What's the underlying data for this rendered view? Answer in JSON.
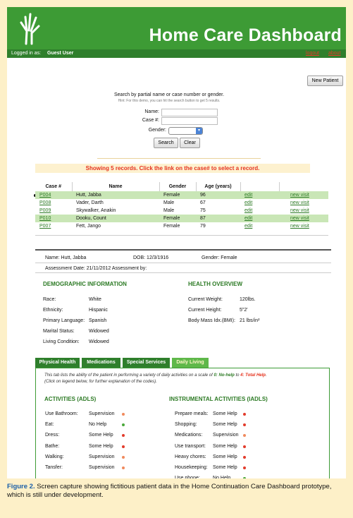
{
  "header": {
    "title": "Home Care Dashboard"
  },
  "subbar": {
    "logged_label": "Logged in as:",
    "user": "Guest User",
    "logout": "logout",
    "about": "about"
  },
  "toolbar": {
    "new_patient": "New Patient"
  },
  "search": {
    "title": "Search by partial name or case number or gender.",
    "hint": "Hint: For this demo, you can hit the search button to get 5 results.",
    "name_label": "Name:",
    "case_label": "Case #:",
    "gender_label": "Gender:",
    "gender_value": "",
    "search_button": "Search",
    "clear_button": "Clear"
  },
  "records": {
    "message": "Showing 5 records. Click the link on the case# to select a record.",
    "columns": [
      "Case #",
      "Name",
      "Gender",
      "Age (years)"
    ],
    "rows": [
      {
        "case": "P004",
        "name": "Hutt, Jabba",
        "gender": "Female",
        "age": "96",
        "edit": "edit",
        "visit": "new visit"
      },
      {
        "case": "P008",
        "name": "Vader, Darth",
        "gender": "Male",
        "age": "67",
        "edit": "edit",
        "visit": "new visit"
      },
      {
        "case": "P009",
        "name": "Skywalker, Anakin",
        "gender": "Male",
        "age": "75",
        "edit": "edit",
        "visit": "new visit"
      },
      {
        "case": "P010",
        "name": "Dooku, Count",
        "gender": "Female",
        "age": "87",
        "edit": "edit",
        "visit": "new visit"
      },
      {
        "case": "P007",
        "name": "Fett, Jango",
        "gender": "Female",
        "age": "79",
        "edit": "edit",
        "visit": "new visit"
      }
    ]
  },
  "patient": {
    "name": "Name: Hutt, Jabba",
    "dob": "DOB: 12/3/1916",
    "gender": "Gender: Female",
    "assessment": "Assessment Date: 21/11/2012  Assessment by:"
  },
  "demographic": {
    "title": "DEMOGRAPHIC INFORMATION",
    "items": [
      {
        "label": "Race:",
        "value": "White"
      },
      {
        "label": "Ethnicity:",
        "value": "Hispanic"
      },
      {
        "label": "Primary Language:",
        "value": "Spanish"
      },
      {
        "label": "Marital Status:",
        "value": "Widowed"
      },
      {
        "label": "Living Condition:",
        "value": "Widowed"
      }
    ]
  },
  "health": {
    "title": "HEALTH OVERVIEW",
    "items": [
      {
        "label": "Current Weight:",
        "value": "120lbs."
      },
      {
        "label": "Current Height:",
        "value": "5\"2'"
      },
      {
        "label": "Body Mass Idx.(BMI):",
        "value": "21 lbs/in²"
      }
    ]
  },
  "tabs": [
    {
      "label": "Physical Health",
      "active": false
    },
    {
      "label": "Medications",
      "active": false
    },
    {
      "label": "Special Services",
      "active": false
    },
    {
      "label": "Daily Living",
      "active": true
    }
  ],
  "daily": {
    "info_1": "This tab lists the ability of the patient in performing a variety of daily activities on a scale of",
    "info_0": "0: No-help",
    "info_to": "to",
    "info_4": "4: Total Help",
    "info_end": ".",
    "info_2": "(Click on legend below, for further explanation of the codes).",
    "adls_title": "ACTIVITIES (ADLS)",
    "iadls_title": "INSTRUMENTAL ACTIVITIES (IADLS)",
    "adls": [
      {
        "label": "Use Bathroom:",
        "value": "Supervision",
        "color": "#f08a5d"
      },
      {
        "label": "Eat:",
        "value": "No Help",
        "color": "#4aa83a"
      },
      {
        "label": "Dress:",
        "value": "Some Help",
        "color": "#e23b2b"
      },
      {
        "label": "Bathe:",
        "value": "Some Help",
        "color": "#e23b2b"
      },
      {
        "label": "Walking:",
        "value": "Supervision",
        "color": "#f08a5d"
      },
      {
        "label": "Tansfer:",
        "value": "Supervision",
        "color": "#f08a5d"
      }
    ],
    "iadls": [
      {
        "label": "Prepare meals:",
        "value": "Some Help",
        "color": "#e23b2b"
      },
      {
        "label": "Shopping:",
        "value": "Some Help",
        "color": "#e23b2b"
      },
      {
        "label": "Medications:",
        "value": "Supervision",
        "color": "#f08a5d"
      },
      {
        "label": "Use transport:",
        "value": "Some Help",
        "color": "#e23b2b"
      },
      {
        "label": "Heavy chores:",
        "value": "Some Help",
        "color": "#e23b2b"
      },
      {
        "label": "Housekeeping:",
        "value": "Some Help",
        "color": "#e23b2b"
      },
      {
        "label": "Use phone:",
        "value": "No Help",
        "color": "#4aa83a"
      }
    ]
  },
  "caption": {
    "label": "Figure 2.",
    "text": " Screen capture showing fictitious patient data in the Home Continuation Care Dashboard prototype, which is still under development."
  },
  "colors": {
    "brand_green": "#3d9b35",
    "dark_green": "#2f7f2c",
    "alert_red": "#e5321d",
    "caption_blue": "#1a5fa8",
    "page_bg": "#fdf0c8"
  }
}
